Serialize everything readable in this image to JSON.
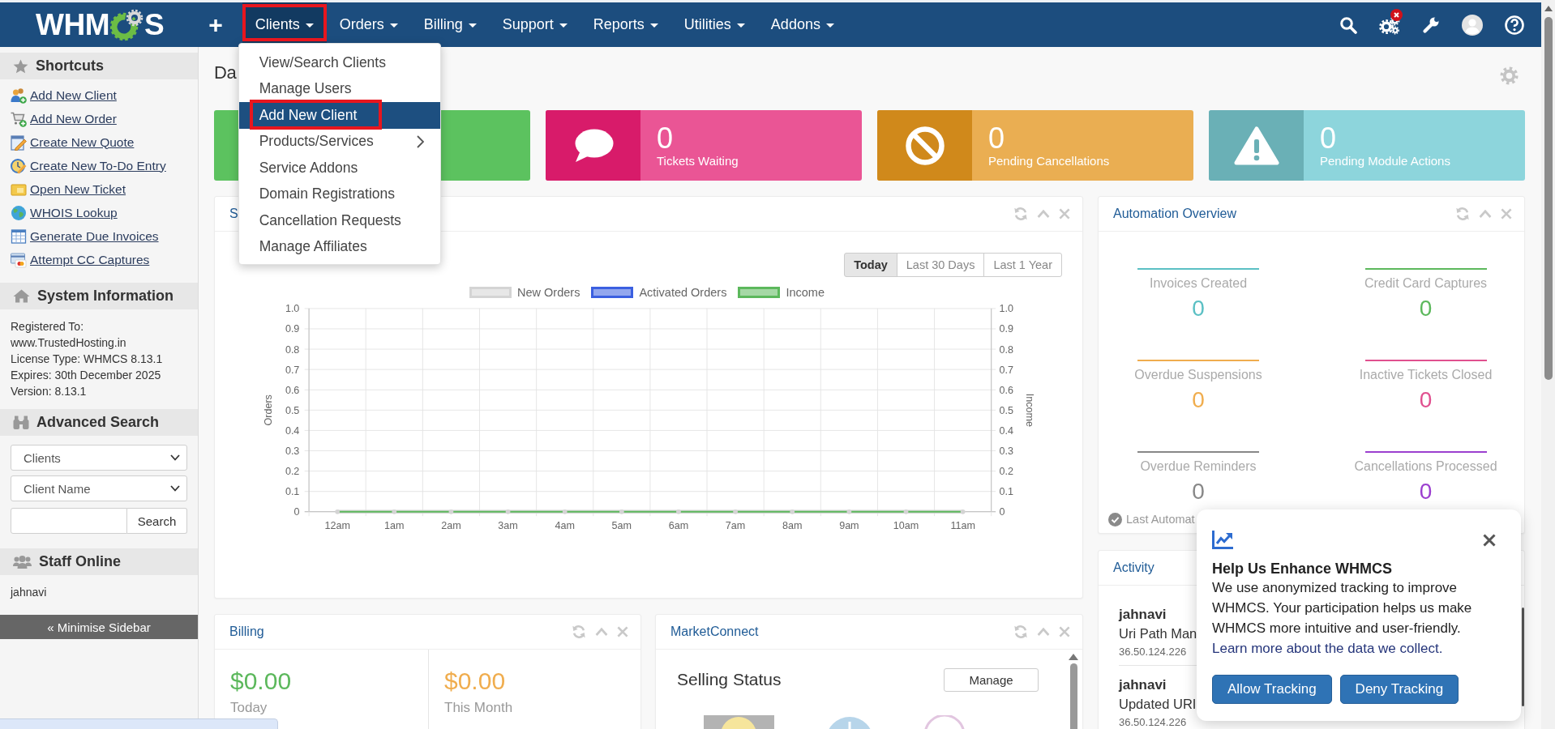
{
  "navbar": {
    "logo": {
      "left": "WHM",
      "right": "S"
    },
    "add": "+",
    "menus": [
      {
        "label": "Clients",
        "open": true,
        "highlighted": true,
        "items": [
          {
            "label": "View/Search Clients",
            "selected": false,
            "highlighted": false,
            "submenu": false
          },
          {
            "label": "Manage Users",
            "selected": false,
            "highlighted": false,
            "submenu": false
          },
          {
            "label": "Add New Client",
            "selected": true,
            "highlighted": true,
            "submenu": false
          },
          {
            "label": "Products/Services",
            "selected": false,
            "highlighted": false,
            "submenu": true
          },
          {
            "label": "Service Addons",
            "selected": false,
            "highlighted": false,
            "submenu": false
          },
          {
            "label": "Domain Registrations",
            "selected": false,
            "highlighted": false,
            "submenu": false
          },
          {
            "label": "Cancellation Requests",
            "selected": false,
            "highlighted": false,
            "submenu": false
          },
          {
            "label": "Manage Affiliates",
            "selected": false,
            "highlighted": false,
            "submenu": false
          }
        ]
      },
      {
        "label": "Orders",
        "open": false,
        "highlighted": false
      },
      {
        "label": "Billing",
        "open": false,
        "highlighted": false
      },
      {
        "label": "Support",
        "open": false,
        "highlighted": false
      },
      {
        "label": "Reports",
        "open": false,
        "highlighted": false
      },
      {
        "label": "Utilities",
        "open": false,
        "highlighted": false
      },
      {
        "label": "Addons",
        "open": false,
        "highlighted": false
      }
    ],
    "tools": [
      {
        "kind": "search",
        "alert": false
      },
      {
        "kind": "automation",
        "alert": true
      },
      {
        "kind": "configure",
        "alert": false
      },
      {
        "kind": "account",
        "alert": false
      },
      {
        "kind": "help",
        "alert": false
      }
    ]
  },
  "sidebar": {
    "sections": [
      {
        "kind": "shortcuts",
        "title": "Shortcuts",
        "links": [
          {
            "kind": "client",
            "label": "Add New Client"
          },
          {
            "kind": "order",
            "label": "Add New Order"
          },
          {
            "kind": "quote",
            "label": "Create New Quote"
          },
          {
            "kind": "todo",
            "label": "Create New To-Do Entry"
          },
          {
            "kind": "ticket",
            "label": "Open New Ticket"
          },
          {
            "kind": "whois",
            "label": "WHOIS Lookup"
          },
          {
            "kind": "invoices",
            "label": "Generate Due Invoices"
          },
          {
            "kind": "cc",
            "label": "Attempt CC Captures"
          }
        ]
      },
      {
        "kind": "system",
        "title": "System Information",
        "lines": [
          "Registered To:",
          "www.TrustedHosting.in",
          "License Type: WHMCS 8.13.1",
          "Expires: 30th December 2025",
          "Version: 8.13.1"
        ]
      },
      {
        "kind": "search",
        "title": "Advanced Search",
        "selects": [
          "Clients",
          "Client Name"
        ],
        "button": "Search"
      },
      {
        "kind": "staff",
        "title": "Staff Online",
        "lines": [
          "jahnavi"
        ]
      }
    ],
    "minimise": "« Minimise Sidebar"
  },
  "page_title": "Da",
  "stat_cards": [
    {
      "color": "#5cc25f"
    },
    {
      "kind": "tickets",
      "color": "#ea5595",
      "icon": {
        "color": "#d81b6a"
      },
      "value": "0",
      "label": "Tickets Waiting"
    },
    {
      "kind": "cancellations",
      "color": "#eaae52",
      "icon": {
        "color": "#d0891b"
      },
      "value": "0",
      "label": "Pending Cancellations"
    },
    {
      "kind": "module_actions",
      "color": "#8dd5dc",
      "icon": {
        "color": "#6ab0b6"
      },
      "value": "0",
      "label": "Pending Module Actions"
    }
  ],
  "overview": {
    "title": "S",
    "ranges": [
      {
        "label": "Today",
        "selected": true
      },
      {
        "label": "Last 30 Days",
        "selected": false
      },
      {
        "label": "Last 1 Year",
        "selected": false
      }
    ],
    "chart_data": {
      "type": "line",
      "legend": "top",
      "categories": [
        "12am",
        "1am",
        "2am",
        "3am",
        "4am",
        "5am",
        "6am",
        "7am",
        "8am",
        "9am",
        "10am",
        "11am"
      ],
      "series": [
        {
          "name": "New Orders",
          "color": "#d4d4d4",
          "marker": true,
          "values": [
            0,
            0,
            0,
            0,
            0,
            0,
            0,
            0,
            0,
            0,
            0,
            0
          ]
        },
        {
          "name": "Activated Orders",
          "color": "#3b5fe0",
          "marker": false,
          "values": [
            null,
            null,
            null,
            null,
            null,
            null,
            null,
            null,
            null,
            null,
            null,
            null
          ]
        },
        {
          "name": "Income",
          "color": "#5cb85c",
          "marker": false,
          "values": [
            0,
            0,
            0,
            0,
            0,
            0,
            0,
            0,
            0,
            0,
            0,
            0
          ]
        }
      ],
      "ylim": [
        0,
        1
      ],
      "ylabel": "Orders",
      "yticks": [
        {
          "value": 0,
          "label": "0"
        },
        {
          "value": 0.1,
          "label": "0.1"
        },
        {
          "value": 0.2,
          "label": "0.2"
        },
        {
          "value": 0.3,
          "label": "0.3"
        },
        {
          "value": 0.4,
          "label": "0.4"
        },
        {
          "value": 0.5,
          "label": "0.5"
        },
        {
          "value": 0.6,
          "label": "0.6"
        },
        {
          "value": 0.7,
          "label": "0.7"
        },
        {
          "value": 0.8,
          "label": "0.8"
        },
        {
          "value": 0.9,
          "label": "0.9"
        },
        {
          "value": 1,
          "label": "1.0"
        }
      ],
      "y2label": "Income",
      "y2lim": [
        0,
        1
      ],
      "y2ticks": [
        {
          "value": 0,
          "label": "0"
        },
        {
          "value": 0.1,
          "label": "0.1"
        },
        {
          "value": 0.2,
          "label": "0.2"
        },
        {
          "value": 0.3,
          "label": "0.3"
        },
        {
          "value": 0.4,
          "label": "0.4"
        },
        {
          "value": 0.5,
          "label": "0.5"
        },
        {
          "value": 0.6,
          "label": "0.6"
        },
        {
          "value": 0.7,
          "label": "0.7"
        },
        {
          "value": 0.8,
          "label": "0.8"
        },
        {
          "value": 0.9,
          "label": "0.9"
        },
        {
          "value": 1,
          "label": "1.0"
        }
      ]
    }
  },
  "automation": {
    "title": "Automation Overview",
    "metrics": [
      {
        "label": "Invoices Created",
        "value": "0",
        "color": "#5bc0c4"
      },
      {
        "label": "Credit Card Captures",
        "value": "0",
        "color": "#5cb85c"
      },
      {
        "label": "Overdue Suspensions",
        "value": "0",
        "color": "#f0ad4e"
      },
      {
        "label": "Inactive Tickets Closed",
        "value": "0",
        "color": "#e0508f"
      },
      {
        "label": "Overdue Reminders",
        "value": "0",
        "color": "#888888"
      },
      {
        "label": "Cancellations Processed",
        "value": "0",
        "color": "#9b3fcf"
      }
    ],
    "footer": "Last Automat"
  },
  "activity": {
    "title": "Activity",
    "entries": [
      {
        "user": "jahnavi",
        "action": "Uri Path Man",
        "ip": "36.50.124.226"
      },
      {
        "user": "jahnavi",
        "action": "Updated URI",
        "ip": "36.50.124.226"
      }
    ]
  },
  "billing": {
    "title": "Billing",
    "stats": [
      {
        "value": "$0.00",
        "label": "Today",
        "color": "#5cb85c"
      },
      {
        "value": "$0.00",
        "label": "This Month",
        "color": "#f0ad4e"
      }
    ]
  },
  "marketconnect": {
    "title": "MarketConnect",
    "heading": "Selling Status",
    "button": "Manage"
  },
  "tracking_popup": {
    "title": "Help Us Enhance WHMCS",
    "body": "We use anonymized tracking to improve WHMCS. Your participation helps us make WHMCS more intuitive and user-friendly.",
    "link": "Learn more about the data we collect.",
    "buttons": [
      "Allow Tracking",
      "Deny Tracking"
    ]
  }
}
